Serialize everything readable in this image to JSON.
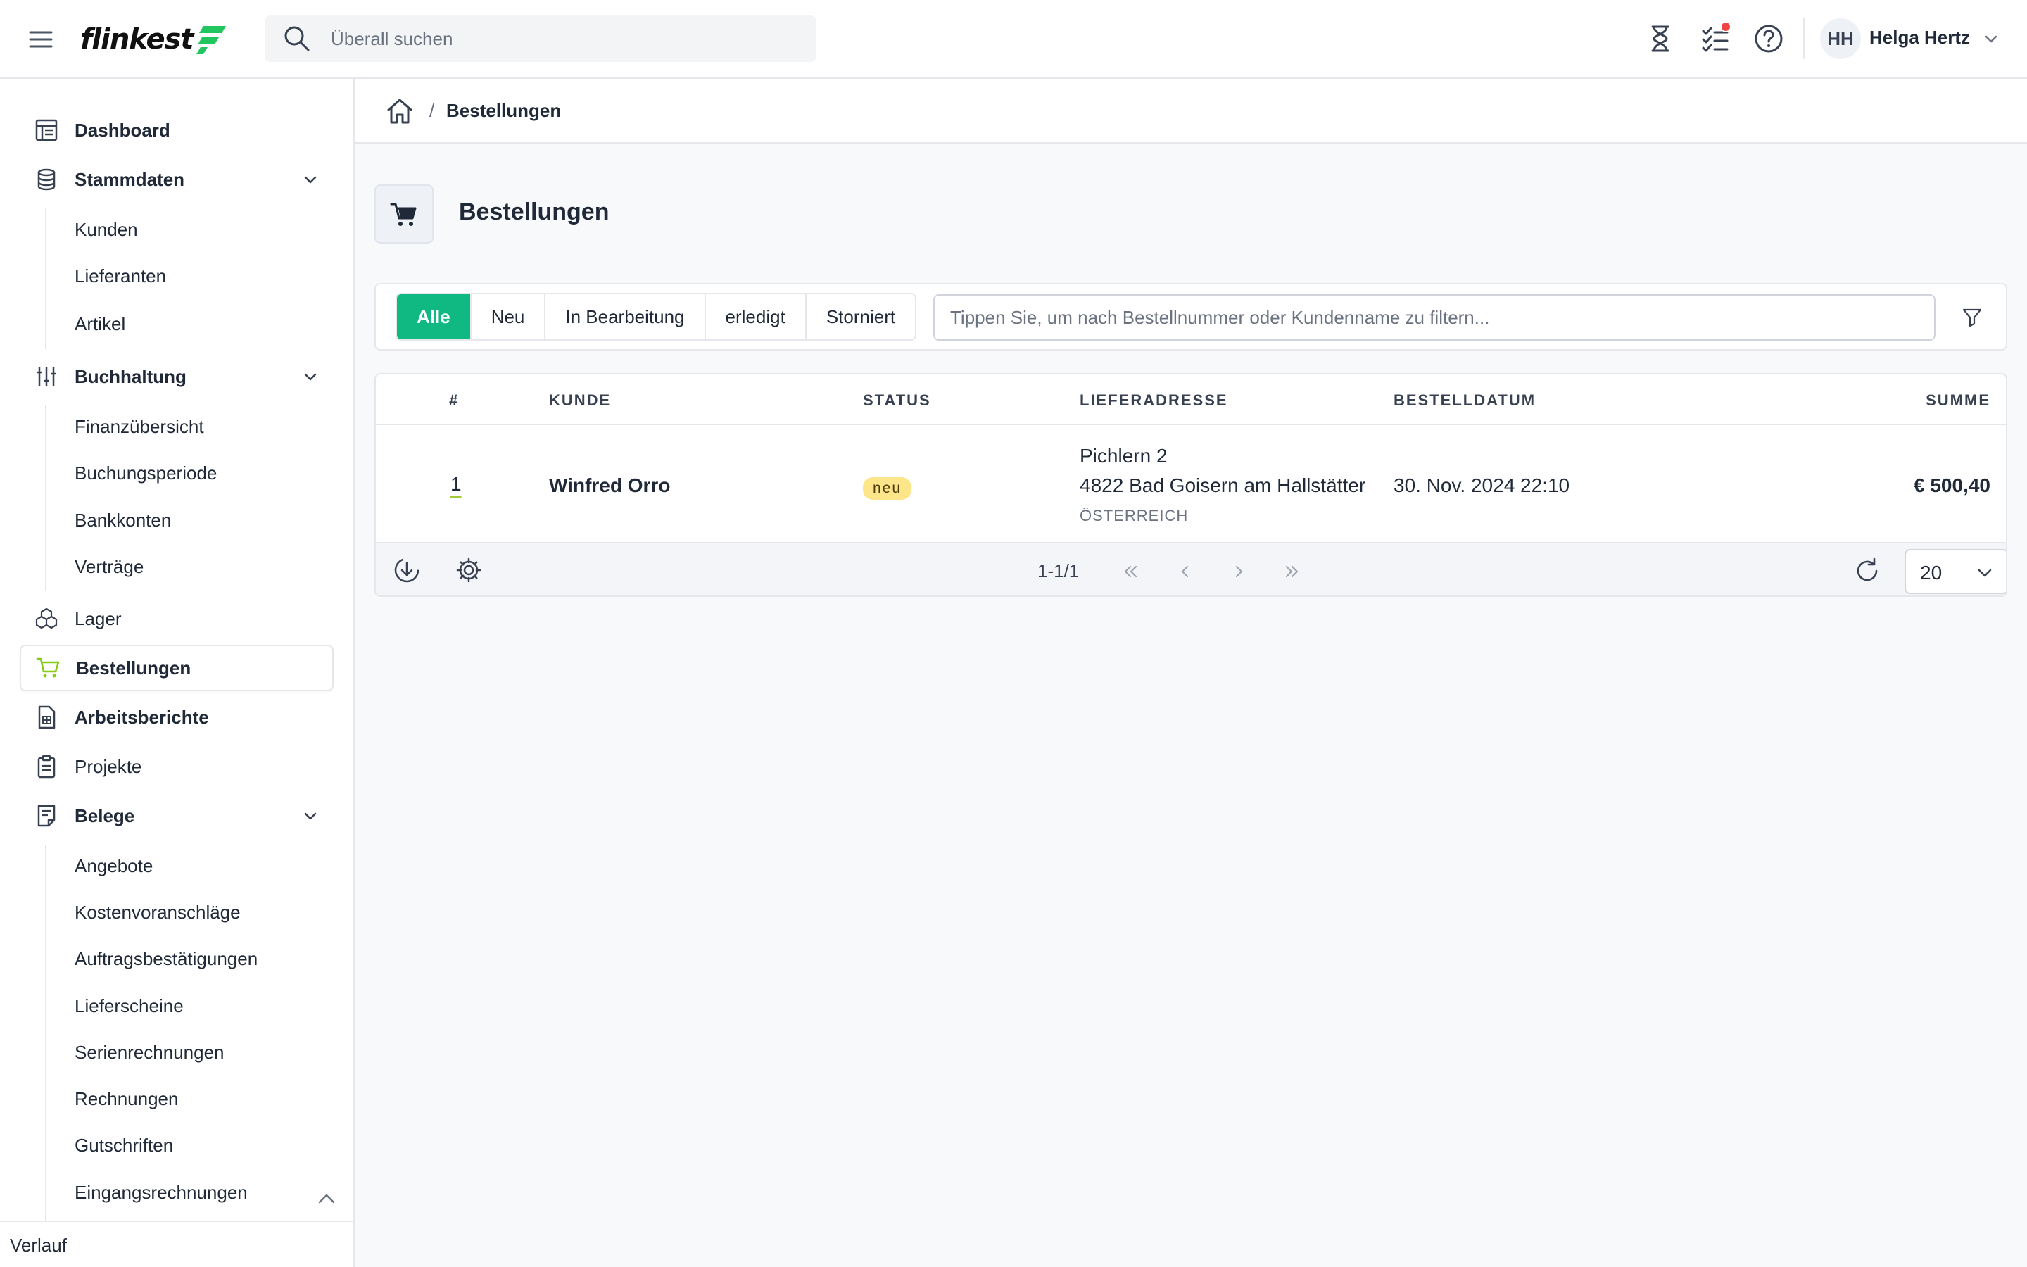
{
  "header": {
    "logo_text": "flinkest",
    "search_placeholder": "Überall suchen",
    "user_initials": "HH",
    "user_name": "Helga Hertz",
    "icons": [
      "menu-icon",
      "hourglass-icon",
      "task-list-icon",
      "help-icon",
      "chevron-down-icon"
    ]
  },
  "sidebar": {
    "items": [
      {
        "label": "Dashboard",
        "icon": "dashboard-icon"
      },
      {
        "label": "Stammdaten",
        "icon": "database-icon",
        "expanded": true,
        "children": [
          "Kunden",
          "Lieferanten",
          "Artikel"
        ]
      },
      {
        "label": "Buchhaltung",
        "icon": "sliders-icon",
        "expanded": true,
        "children": [
          "Finanzübersicht",
          "Buchungsperiode",
          "Bankkonten",
          "Verträge"
        ]
      },
      {
        "label": "Lager",
        "icon": "boxes-icon"
      },
      {
        "label": "Bestellungen",
        "icon": "cart-icon",
        "active": true
      },
      {
        "label": "Arbeitsberichte",
        "icon": "report-icon"
      },
      {
        "label": "Projekte",
        "icon": "clipboard-icon"
      },
      {
        "label": "Belege",
        "icon": "receipt-icon",
        "expanded": true,
        "children": [
          "Angebote",
          "Kostenvoranschläge",
          "Auftragsbestätigungen",
          "Lieferscheine",
          "Serienrechnungen",
          "Rechnungen",
          "Gutschriften",
          "Eingangsrechnungen"
        ]
      }
    ],
    "footer_label": "Verlauf"
  },
  "breadcrumb": {
    "current": "Bestellungen",
    "separator": "/"
  },
  "page": {
    "title": "Bestellungen"
  },
  "filters": {
    "tabs": [
      "Alle",
      "Neu",
      "In Bearbeitung",
      "erledigt",
      "Storniert"
    ],
    "active_tab": "Alle",
    "search_placeholder": "Tippen Sie, um nach Bestellnummer oder Kundenname zu filtern..."
  },
  "table": {
    "columns": [
      "#",
      "KUNDE",
      "STATUS",
      "LIEFERADRESSE",
      "BESTELLDATUM",
      "SUMME"
    ],
    "rows": [
      {
        "number": "1",
        "customer": "Winfred Orro",
        "status": "neu",
        "address_line1": "Pichlern 2",
        "address_line2": "4822 Bad Goisern am Hallstätter",
        "address_country": "ÖSTERREICH",
        "date": "30. Nov. 2024 22:10",
        "sum": "€ 500,40"
      }
    ],
    "pagination": {
      "range": "1-1/1",
      "per_page": "20"
    }
  },
  "colors": {
    "accent": "#10b981",
    "brand_green": "#22c55e",
    "badge_new": "#fde68a",
    "notification": "#ef4444"
  }
}
